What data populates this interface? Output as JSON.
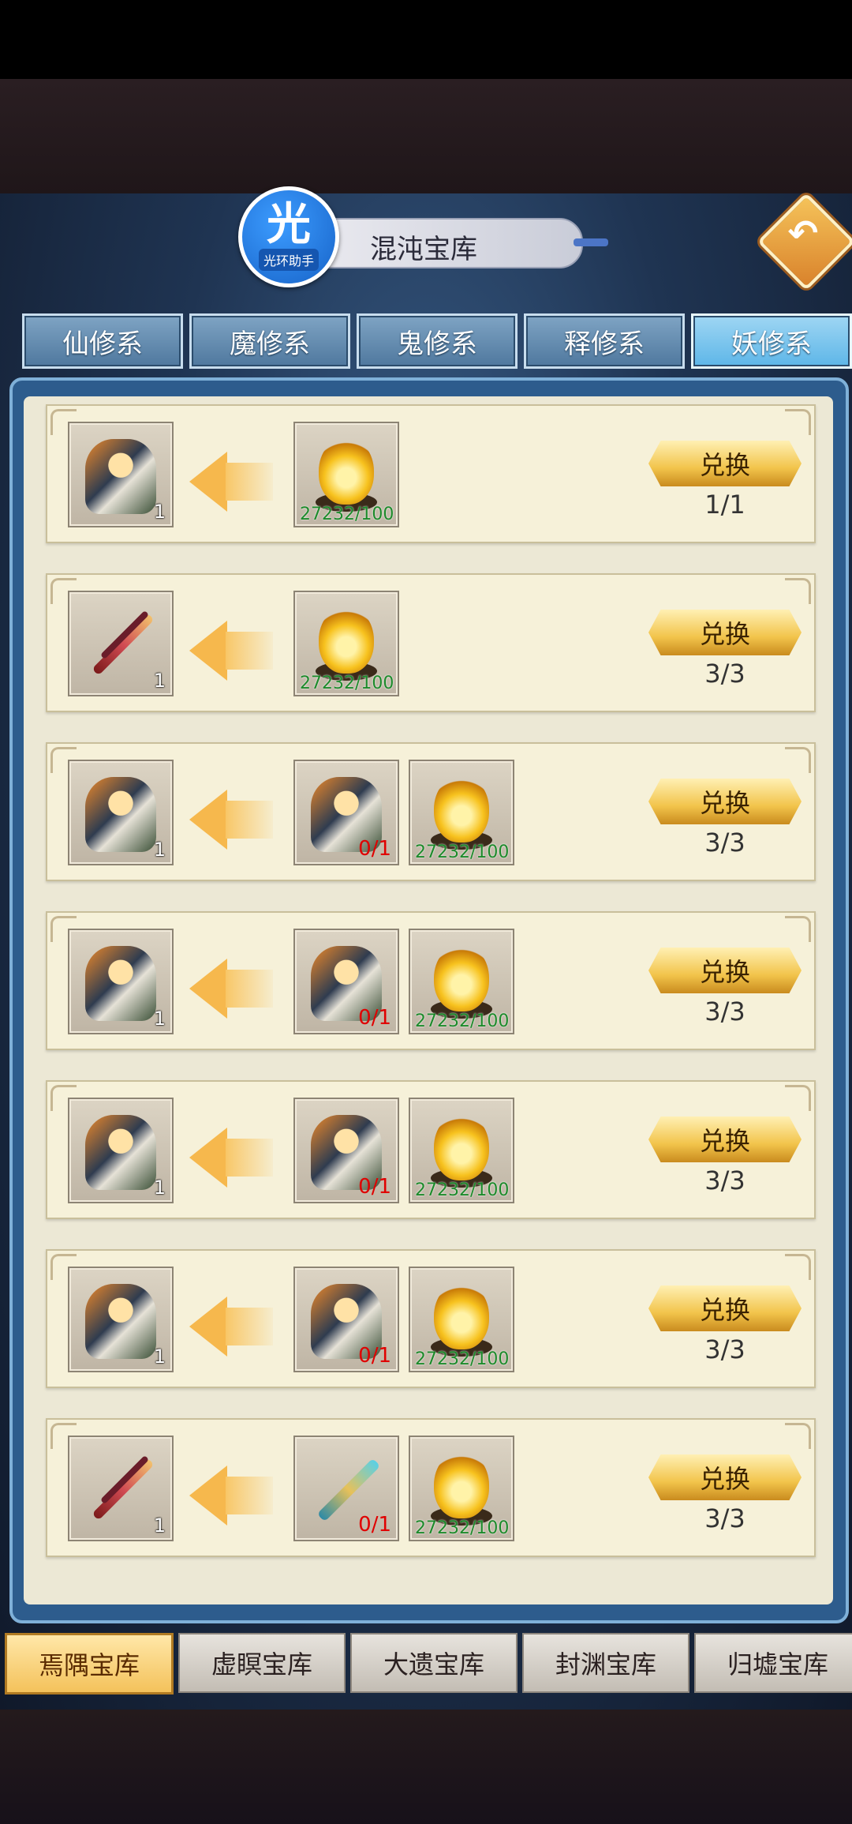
{
  "header": {
    "title": "混沌宝库",
    "logo_main": "光",
    "logo_sub": "光环助手",
    "back_icon": "back-arrow-icon"
  },
  "tabs": [
    {
      "label": "仙修系",
      "active": false
    },
    {
      "label": "魔修系",
      "active": false
    },
    {
      "label": "鬼修系",
      "active": false
    },
    {
      "label": "释修系",
      "active": false
    },
    {
      "label": "妖修系",
      "active": true
    }
  ],
  "rows": [
    {
      "reward": "costume",
      "reward_count": "1",
      "costs": [
        {
          "type": "flame",
          "text": "27232/100"
        }
      ],
      "button": "兑换",
      "limit": "1/1"
    },
    {
      "reward": "bow",
      "reward_count": "1",
      "costs": [
        {
          "type": "flame",
          "text": "27232/100"
        }
      ],
      "button": "兑换",
      "limit": "3/3"
    },
    {
      "reward": "costume",
      "reward_count": "1",
      "costs": [
        {
          "type": "costume",
          "text": "0/1"
        },
        {
          "type": "flame",
          "text": "27232/100"
        }
      ],
      "button": "兑换",
      "limit": "3/3"
    },
    {
      "reward": "costume",
      "reward_count": "1",
      "costs": [
        {
          "type": "costume",
          "text": "0/1"
        },
        {
          "type": "flame",
          "text": "27232/100"
        }
      ],
      "button": "兑换",
      "limit": "3/3"
    },
    {
      "reward": "costume",
      "reward_count": "1",
      "costs": [
        {
          "type": "costume",
          "text": "0/1"
        },
        {
          "type": "flame",
          "text": "27232/100"
        }
      ],
      "button": "兑换",
      "limit": "3/3"
    },
    {
      "reward": "costume",
      "reward_count": "1",
      "costs": [
        {
          "type": "costume",
          "text": "0/1"
        },
        {
          "type": "flame",
          "text": "27232/100"
        }
      ],
      "button": "兑换",
      "limit": "3/3"
    },
    {
      "reward": "bow",
      "reward_count": "1",
      "costs": [
        {
          "type": "sword",
          "text": "0/1"
        },
        {
          "type": "flame",
          "text": "27232/100"
        }
      ],
      "button": "兑换",
      "limit": "3/3"
    }
  ],
  "bottom_tabs": [
    {
      "label": "焉隅宝库",
      "active": true
    },
    {
      "label": "虚瞑宝库",
      "active": false
    },
    {
      "label": "大遗宝库",
      "active": false
    },
    {
      "label": "封渊宝库",
      "active": false
    },
    {
      "label": "归墟宝库",
      "active": false
    }
  ]
}
